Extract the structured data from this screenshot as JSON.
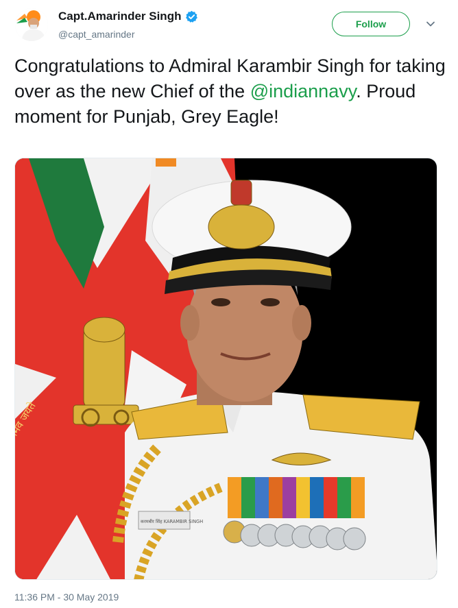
{
  "tweet": {
    "display_name": "Capt.Amarinder Singh",
    "handle": "@capt_amarinder",
    "follow_label": "Follow",
    "text_before": "Congratulations to Admiral Karambir Singh for taking over as the new Chief of the ",
    "mention": "@indiannavy",
    "text_after": ". Proud moment for Punjab, Grey Eagle!",
    "timestamp": "11:36 PM - 30 May 2019",
    "photo_flag_text": "सत्यमेव जयते",
    "photo_nameplate_text": "करमबीर सिंह KARAMBIR SINGH"
  },
  "icons": {
    "verified": "verified-badge-icon",
    "caret": "chevron-down-icon"
  },
  "colors": {
    "accent_green": "#1b9e4b",
    "verified_blue": "#1da1f2",
    "secondary_text": "#657786"
  }
}
